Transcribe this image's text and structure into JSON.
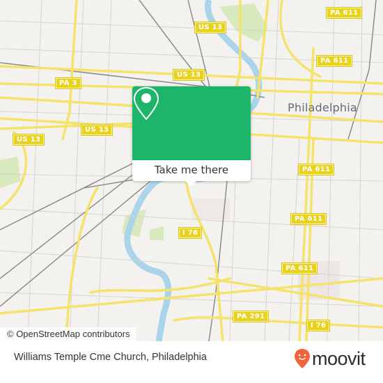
{
  "map": {
    "city_label": "Philadelphia",
    "attribution": "© OpenStreetMap contributors",
    "route_shields": [
      {
        "label": "PA 611"
      },
      {
        "label": "PA 611"
      },
      {
        "label": "US 13"
      },
      {
        "label": "US 13"
      },
      {
        "label": "PA 3"
      },
      {
        "label": "US 13"
      },
      {
        "label": "US 13"
      },
      {
        "label": "PA 611"
      },
      {
        "label": "PA 611"
      },
      {
        "label": "I 76"
      },
      {
        "label": "PA 611"
      },
      {
        "label": "PA 291"
      },
      {
        "label": "I 76"
      }
    ],
    "colors": {
      "road": "#f6e36a",
      "water": "#a9d4e9",
      "park": "#d5e8b8",
      "rail": "#8a8a8a",
      "background": "#f3f2ee"
    }
  },
  "popup": {
    "icon": "map-pin-icon",
    "button_label": "Take me there",
    "accent_color": "#1db56a"
  },
  "footer": {
    "place_title": "Williams Temple Cme Church, Philadelphia",
    "brand": "moovit",
    "brand_color": "#f0643c"
  }
}
